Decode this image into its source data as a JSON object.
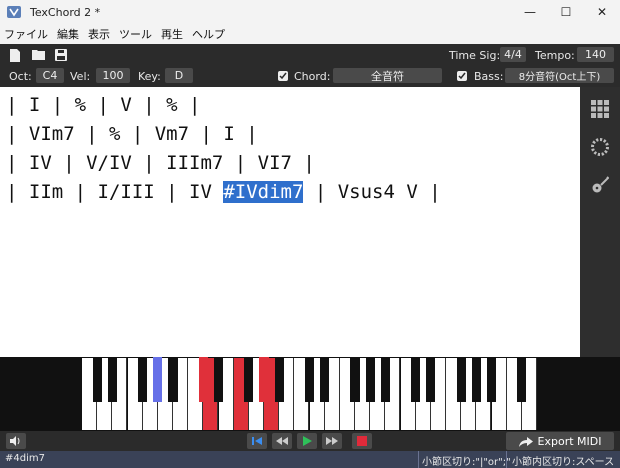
{
  "window": {
    "title": "TexChord 2 *",
    "minimize": "—",
    "maximize": "☐",
    "close": "✕"
  },
  "menu": [
    "ファイル",
    "編集",
    "表示",
    "ツール",
    "再生",
    "ヘルプ"
  ],
  "toolbar": {
    "time_sig_label": "Time Sig:",
    "time_sig_value": "4/4",
    "tempo_label": "Tempo:",
    "tempo_value": "140",
    "oct_label": "Oct:",
    "oct_value": "C4",
    "vel_label": "Vel:",
    "vel_value": "100",
    "key_label": "Key:",
    "key_value": "D",
    "chord_label": "Chord:",
    "chord_value": "全音符",
    "chord_checked": true,
    "bass_label": "Bass:",
    "bass_value": "8分音符(Oct上下)",
    "bass_checked": true
  },
  "editor": {
    "lines": [
      {
        "before": "| I | % | V | % |",
        "selected": "",
        "after": ""
      },
      {
        "before": "| VIm7 | % | Vm7 | I |",
        "selected": "",
        "after": ""
      },
      {
        "before": "| IV | V/IV | IIIm7 | VI7 |",
        "selected": "",
        "after": ""
      },
      {
        "before": "| IIm | I/III | IV ",
        "selected": "#IVdim7",
        "after": " | Vsus4 V |"
      }
    ]
  },
  "sidepanel": [
    "grid-icon",
    "circle-of-fifths-icon",
    "guitar-icon"
  ],
  "piano": {
    "white_key_count": 30,
    "highlight_white": [
      8,
      10,
      12
    ],
    "highlight_black": [
      {
        "after_white": 4,
        "color": "#6670e8"
      },
      {
        "after_white": 7,
        "color": "#e0303a"
      },
      {
        "after_white": 9,
        "color": "#e0303a"
      },
      {
        "after_white": 11,
        "color": "#e0303a"
      }
    ],
    "black_after": [
      0,
      1,
      3,
      4,
      5,
      7,
      8,
      10,
      11,
      12,
      14,
      15,
      17,
      18,
      19,
      21,
      22,
      24,
      25,
      26,
      28
    ],
    "red": "#e0303a"
  },
  "transport": {
    "export_label": "Export MIDI"
  },
  "status": {
    "left": "#4dim7",
    "right1": "小節区切り:\"|\"or\";\"",
    "right2": "小節内区切り:スペース"
  }
}
